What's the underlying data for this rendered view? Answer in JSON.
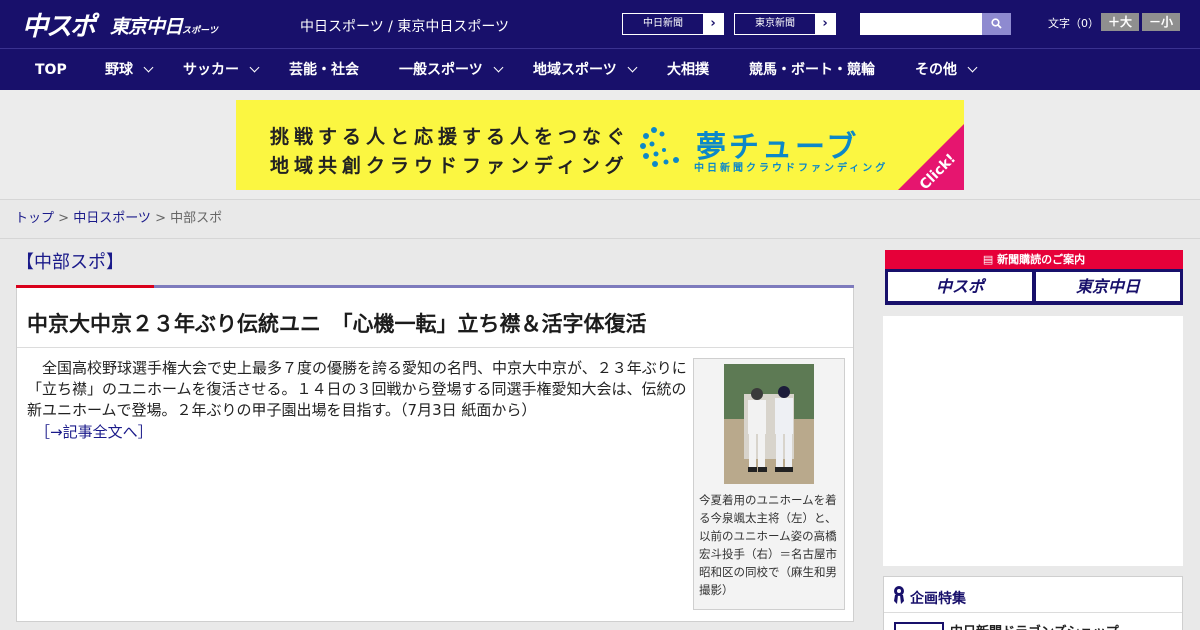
{
  "header": {
    "logo_main": "中スポ",
    "logo_tokyo": "東京中日",
    "logo_tokyo_sub": "スポーツ",
    "site_links": "中日スポーツ / 東京中日スポーツ",
    "paper_links": [
      {
        "label": "中日新聞"
      },
      {
        "label": "東京新聞"
      }
    ],
    "search_placeholder": "",
    "font_size_label": "文字（0）",
    "font_bigger": "＋大",
    "font_smaller": "－小"
  },
  "nav": {
    "items": [
      {
        "label": "TOP",
        "dropdown": false
      },
      {
        "label": "野球",
        "dropdown": true
      },
      {
        "label": "サッカー",
        "dropdown": true
      },
      {
        "label": "芸能・社会",
        "dropdown": false
      },
      {
        "label": "一般スポーツ",
        "dropdown": true
      },
      {
        "label": "地域スポーツ",
        "dropdown": true
      },
      {
        "label": "大相撲",
        "dropdown": false
      },
      {
        "label": "競馬・ボート・競輪",
        "dropdown": false
      },
      {
        "label": "その他",
        "dropdown": true
      }
    ]
  },
  "banner": {
    "line1": "挑戦する人と応援する人をつなぐ",
    "line2": "地域共創クラウドファンディング",
    "brand": "夢チューブ",
    "sub": "中日新聞クラウドファンディング",
    "click": "Click!"
  },
  "breadcrumb": {
    "home": "トップ",
    "sep": " > ",
    "level2": "中日スポーツ",
    "current": "中部スポ"
  },
  "section": {
    "title": "【中部スポ】"
  },
  "article": {
    "title": "中京大中京２３年ぶり伝統ユニ　「心機一転」立ち襟＆活字体復活",
    "body": "全国高校野球選手権大会で史上最多７度の優勝を誇る愛知の名門、中京大中京が、２３年ぶりに「立ち襟」のユニホームを復活させる。１４日の３回戦から登場する同選手権愛知大会は、伝統の新ユニホームで登場。２年ぶりの甲子園出場を目指す。（7月3日 紙面から）",
    "more_link": "［→記事全文へ］",
    "photo_caption": "今夏着用のユニホームを着る今泉颯太主将（左）と、以前のユニホーム姿の高橋宏斗投手（右）＝名古屋市昭和区の同校で（麻生和男撮影）"
  },
  "sidebar": {
    "subscribe_head": "新聞購読のご案内",
    "subscribe_buttons": [
      "中スポ",
      "東京中日"
    ],
    "feature_title": "企画特集",
    "feature_item": "中日新聞ドラゴンズショップ"
  },
  "colors": {
    "header_bg": "#18106b",
    "accent_red": "#d9001b",
    "banner_yellow": "#fbf641",
    "banner_blue": "#0c88c8",
    "banner_pink": "#e6156f"
  }
}
